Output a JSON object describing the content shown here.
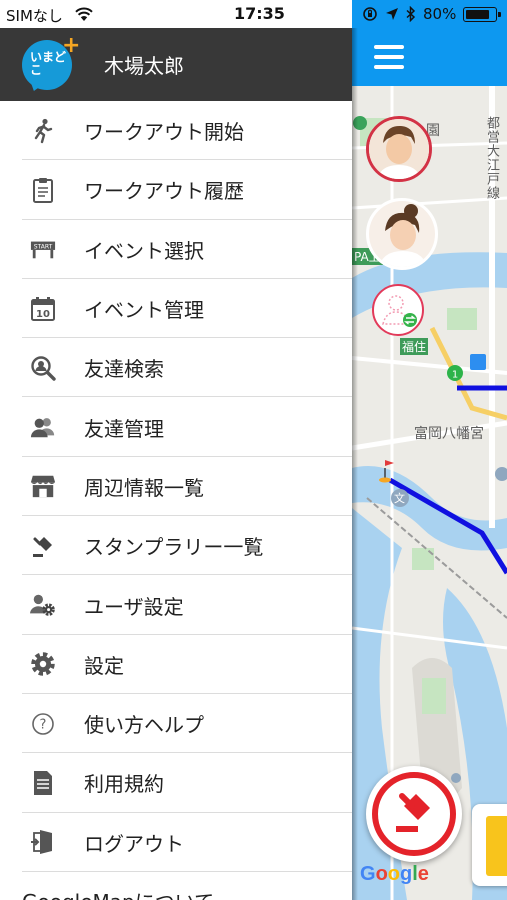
{
  "status_bar": {
    "carrier": "SIMなし",
    "time": "17:35",
    "battery": "80%",
    "battery_level": 0.8,
    "icons": [
      "wifi-icon",
      "orientation-lock-icon",
      "location-arrow-icon",
      "bluetooth-icon",
      "battery-icon"
    ]
  },
  "drawer": {
    "user_name": "木場太郎",
    "logo_text": "いまどこ",
    "logo_plus": "+",
    "items": [
      {
        "label": "ワークアウト開始",
        "icon": "running-icon"
      },
      {
        "label": "ワークアウト履歴",
        "icon": "clipboard-icon"
      },
      {
        "label": "イベント選択",
        "icon": "start-line-icon"
      },
      {
        "label": "イベント管理",
        "icon": "calendar-icon"
      },
      {
        "label": "友達検索",
        "icon": "search-user-icon"
      },
      {
        "label": "友達管理",
        "icon": "friends-icon"
      },
      {
        "label": "周辺情報一覧",
        "icon": "store-icon"
      },
      {
        "label": "スタンプラリー一覧",
        "icon": "stamp-icon"
      },
      {
        "label": "ユーザ設定",
        "icon": "user-gear-icon"
      },
      {
        "label": "設定",
        "icon": "gear-icon"
      },
      {
        "label": "使い方ヘルプ",
        "icon": "help-icon"
      },
      {
        "label": "利用規約",
        "icon": "document-icon"
      },
      {
        "label": "ログアウト",
        "icon": "logout-icon"
      }
    ],
    "partial_item": "GoogleMapについて"
  },
  "map": {
    "labels": {
      "park": "園",
      "highway": "都営大江戸線",
      "pa": "PA上",
      "fukuzumi": "福住",
      "tomioka": "富岡八幡宮",
      "bunkyo": "文"
    },
    "google": "Google",
    "icons": [
      "menu-icon",
      "stamp-button-icon"
    ],
    "colors": {
      "topbar": "#0d98f0",
      "route": "#1010e0",
      "stamp": "#e4232a"
    }
  }
}
